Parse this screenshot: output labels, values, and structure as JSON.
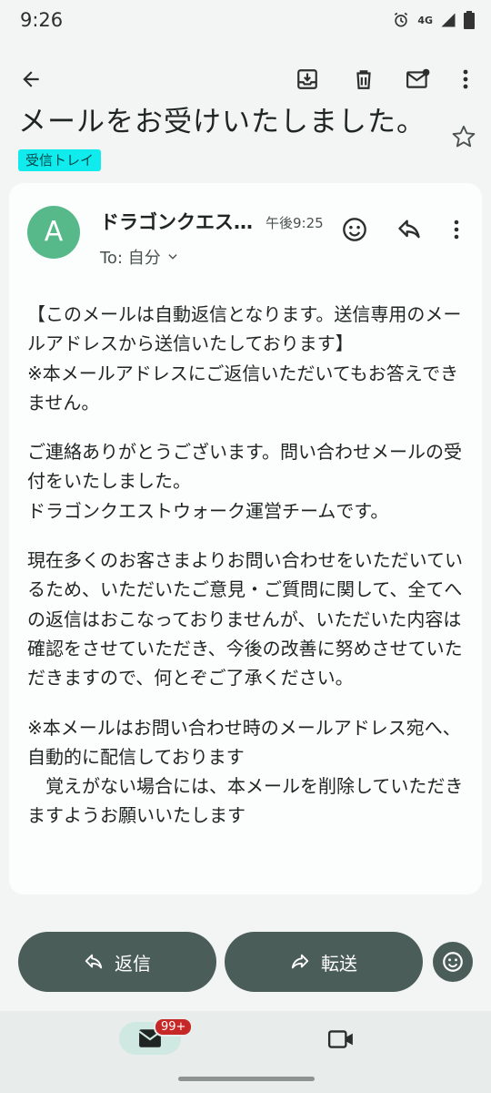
{
  "status_bar": {
    "time": "9:26",
    "network": "4G",
    "icons": [
      "alarm-icon",
      "signal-icon",
      "battery-icon"
    ]
  },
  "app_bar": {
    "icons": [
      "back-arrow-icon",
      "archive-icon",
      "delete-icon",
      "mark-unread-icon",
      "more-vert-icon"
    ]
  },
  "email": {
    "subject": "メールをお受けいたしました。",
    "label": "受信トレイ",
    "sender_initial": "A",
    "sender_name": "ドラゴンクエス…",
    "time": "午後9:25",
    "to": "To: 自分",
    "body": [
      "【このメールは自動返信となります。送信専用のメールアドレスから送信いたしております】\n※本メールアドレスにご返信いただいてもお答えできません。",
      "ご連絡ありがとうございます。問い合わせメールの受付をいたしました。\nドラゴンクエストウォーク運営チームです。",
      "現在多くのお客さまよりお問い合わせをいただいているため、いただいたご意見・ご質問に関して、全てへの返信はおこなっておりませんが、いただいた内容は確認をさせていただき、今後の改善に努めさせていただきますので、何とぞご了承ください。",
      "※本メールはお問い合わせ時のメールアドレス宛へ、自動的に配信しております\n　覚えがない場合には、本メールを削除していただきますようお願いいたします"
    ]
  },
  "actions": {
    "reply_label": "返信",
    "forward_label": "転送"
  },
  "bottom_nav": {
    "mail_badge": "99+"
  },
  "colors": {
    "label_chip": "#10ecee",
    "avatar": "#57b98a",
    "action_button": "#4b5d59",
    "badge": "#c62828"
  }
}
